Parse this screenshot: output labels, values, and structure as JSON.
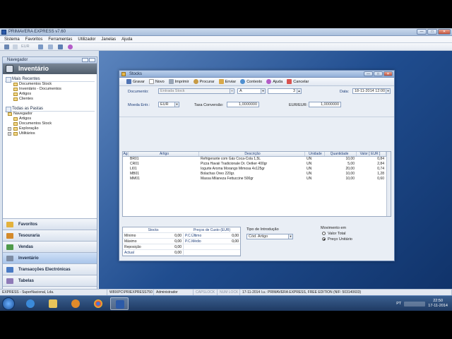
{
  "app": {
    "title": "PRIMAVERA EXPRESS v7.60",
    "menu": [
      "Sistema",
      "Favoritos",
      "Ferramentas",
      "Utilizador",
      "Janelas",
      "Ajuda"
    ],
    "toolbar_text": "EUR"
  },
  "navigator": {
    "header": "Navegador",
    "banner": "Inventário",
    "recent_title": "Mais Recentes",
    "recent_items": [
      "Documentos Stock",
      "Inventário - Documentos",
      "Artigos",
      "Clientes"
    ],
    "all_title": "Todas as Pastas",
    "tree_root": "Navegador",
    "tree_items": [
      "Artigos",
      "Documentos Stock",
      "Exploração",
      "Utilitários"
    ],
    "modules": [
      "Favoritos",
      "Tesouraria",
      "Vendas",
      "Inventário",
      "Transacções Electrónicas",
      "Tabelas"
    ]
  },
  "stocks": {
    "title": "Stocks",
    "tools": [
      "Gravar",
      "Novo",
      "Imprimir",
      "Procurar",
      "Enviar",
      "Contexto",
      "Ajuda",
      "Cancelar"
    ],
    "form": {
      "documento_label": "Documento:",
      "documento_value": "Entrada Stock",
      "serie_value": "A",
      "numero_value": "3",
      "data_label": "Data:",
      "data_value": "18-11-2014 12:00",
      "moeda_label": "Moeda Entr.:",
      "moeda_value": "EUR",
      "taxa_label": "Taxa Conversão:",
      "taxa_value": "1,0000000",
      "eur_label": "EUR/EUR:",
      "eur_value": "1,0000000"
    },
    "grid": {
      "headers": [
        "Ag",
        "Artigo",
        "Descrição",
        "Unidade",
        "Quantidade",
        "Valor [ EUR ]"
      ],
      "rows": [
        [
          "",
          "BR01",
          "Refrigerante com Gás Coca-Cola 1,5L",
          "UN",
          "10,00",
          "0,84"
        ],
        [
          "",
          "CR01",
          "Pizza Havaii Tradicionale Dr. Oetker 400gr",
          "UN",
          "5,00",
          "2,84"
        ],
        [
          "",
          "LI01",
          "Iogurte Aroma Morango Mimosa 4x125gr",
          "UN",
          "20,00",
          "0,74"
        ],
        [
          "",
          "MB01",
          "Bolachas Oreo 220gr.",
          "UN",
          "10,00",
          "1,28"
        ],
        [
          "",
          "MM01",
          "Massa Milaneza Fettuccine 500gr",
          "UN",
          "10,00",
          "0,60"
        ]
      ]
    },
    "summary": {
      "stocks_header": "Stocks",
      "custo_header": "Preços de Custo  (EUR)",
      "rows": [
        {
          "label": "Mínimo",
          "value": "0,00",
          "label2": "P.C.Último",
          "value2": "0,00"
        },
        {
          "label": "Máximo",
          "value": "0,00",
          "label2": "P.C.Médio",
          "value2": "0,00"
        },
        {
          "label": "Reposição",
          "value": "0,00",
          "label2": "",
          "value2": ""
        },
        {
          "label": "Actual",
          "value": "0,00",
          "label2": "",
          "value2": ""
        }
      ],
      "tipo_label": "Tipo de Introdução",
      "tipo_value": "Cód. Artigo",
      "mov_label": "Movimento em",
      "mov_options": [
        "Valor Total",
        "Preço Unitário"
      ]
    }
  },
  "statusbar": {
    "company": "EXPRESS - SuperNacional, Lda.",
    "server": "W8IXPC\\PRIEXPRESS750",
    "user": "Administrador",
    "caps": "CAPSLOCK",
    "num": "NUM LOCK",
    "info": "17-11-2014  l.u.: PRIMAVERA EXPRESS, FREE EDITION (NIF: 503140603)"
  },
  "taskbar": {
    "lang": "PT",
    "time": "22:50",
    "date": "17-11-2014"
  }
}
